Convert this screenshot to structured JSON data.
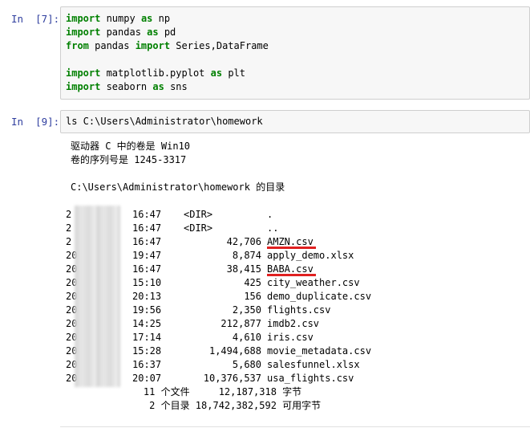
{
  "cell1": {
    "prompt": "In  [7]:",
    "lines": [
      {
        "kw1": "import",
        "mid": " numpy ",
        "kw2": "as",
        "rest": " np"
      },
      {
        "kw1": "import",
        "mid": " pandas ",
        "kw2": "as",
        "rest": " pd"
      },
      {
        "kw1": "from",
        "mid": " pandas ",
        "kw2": "import",
        "rest": " Series,DataFrame"
      },
      {
        "kw1": "",
        "mid": "",
        "kw2": "",
        "rest": ""
      },
      {
        "kw1": "import",
        "mid": " matplotlib.pyplot ",
        "kw2": "as",
        "rest": " plt"
      },
      {
        "kw1": "import",
        "mid": " seaborn ",
        "kw2": "as",
        "rest": " sns"
      }
    ]
  },
  "cell2": {
    "prompt": "In  [9]:",
    "command": "ls C:\\Users\\Administrator\\homework",
    "output_header": [
      "驱动器 C 中的卷是 Win10",
      "卷的序列号是 1245-3317",
      "",
      "C:\\Users\\Administrator\\homework 的目录"
    ],
    "entries": [
      {
        "date": "2",
        "time": "16:47",
        "dir": "<DIR>",
        "size": "",
        "name": "."
      },
      {
        "date": "2",
        "time": "16:47",
        "dir": "<DIR>",
        "size": "",
        "name": ".."
      },
      {
        "date": "2",
        "time": "16:47",
        "dir": "",
        "size": "42,706",
        "name": "AMZN.csv"
      },
      {
        "date": "20",
        "time": "19:47",
        "dir": "",
        "size": "8,874",
        "name": "apply_demo.xlsx"
      },
      {
        "date": "20",
        "time": "16:47",
        "dir": "",
        "size": "38,415",
        "name": "BABA.csv"
      },
      {
        "date": "20",
        "time": "15:10",
        "dir": "",
        "size": "425",
        "name": "city_weather.csv"
      },
      {
        "date": "20",
        "time": "20:13",
        "dir": "",
        "size": "156",
        "name": "demo_duplicate.csv"
      },
      {
        "date": "20",
        "time": "19:56",
        "dir": "",
        "size": "2,350",
        "name": "flights.csv"
      },
      {
        "date": "20",
        "time": "14:25",
        "dir": "",
        "size": "212,877",
        "name": "imdb2.csv"
      },
      {
        "date": "20",
        "time": "17:14",
        "dir": "",
        "size": "4,610",
        "name": "iris.csv"
      },
      {
        "date": "20",
        "time": "15:28",
        "dir": "",
        "size": "1,494,688",
        "name": "movie_metadata.csv"
      },
      {
        "date": "20",
        "time": "16:37",
        "dir": "",
        "size": "5,680",
        "name": "salesfunnel.xlsx"
      },
      {
        "date": "20",
        "time": "20:07",
        "dir": "",
        "size": "10,376,537",
        "name": "usa_flights.csv"
      }
    ],
    "summary": [
      "    11 个文件     12,187,318 字节",
      "     2 个目录 18,742,382,592 可用字节"
    ],
    "highlighted": [
      "AMZN.csv",
      "BABA.csv"
    ]
  },
  "colors": {
    "prompt": "#303f9f",
    "keyword": "#008000",
    "input_bg": "#f7f7f7",
    "input_border": "#cfcfcf",
    "underline": "#e02020"
  }
}
